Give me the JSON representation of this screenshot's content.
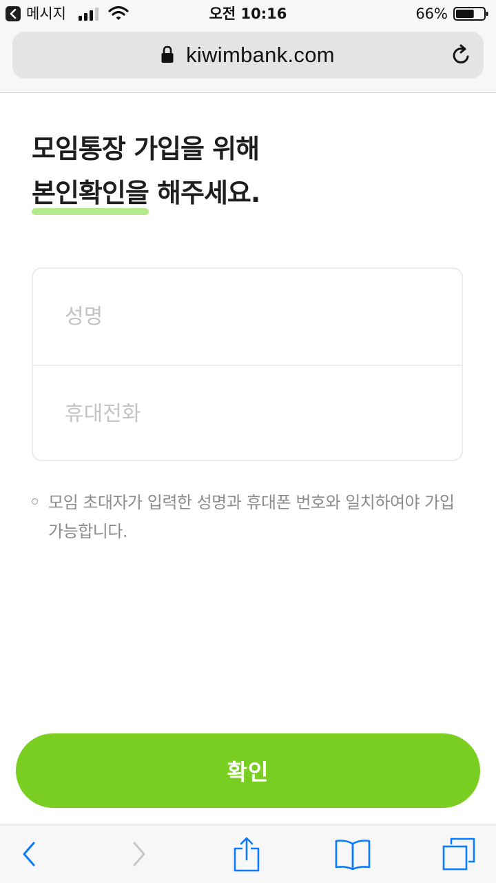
{
  "status_bar": {
    "back_app": "메시지",
    "time": "오전 10:16",
    "battery": "66%",
    "battery_level": 0.66,
    "signal_bars": 3,
    "signal_bars_total": 4
  },
  "browser": {
    "url": "kiwimbank.com",
    "icons": {
      "lock": "lock-icon",
      "reload": "reload-icon"
    }
  },
  "headline": {
    "line1": "모임통장 가입을 위해",
    "line2_highlight": "본인확인을",
    "line2_rest": " 해주세요."
  },
  "form": {
    "name_placeholder": "성명",
    "phone_placeholder": "휴대전화"
  },
  "notice": {
    "text": "모임 초대자가 입력한 성명과 휴대폰 번호와 일치하여야 가입 가능합니다."
  },
  "confirm_button": {
    "label": "확인"
  },
  "toolbar": {
    "icons": [
      "back-icon",
      "forward-icon",
      "share-icon",
      "bookmarks-icon",
      "tabs-icon"
    ]
  },
  "colors": {
    "accent": "#7ace21",
    "highlight": "#b4ea8c",
    "ios_blue": "#0a7aff",
    "disabled": "#c8c8cc"
  }
}
